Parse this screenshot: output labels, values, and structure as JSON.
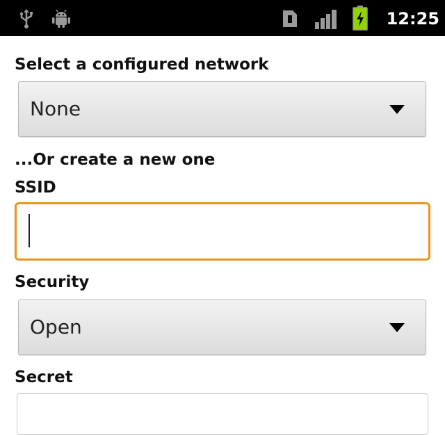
{
  "status_bar": {
    "time": "12:25",
    "icons": [
      "usb-icon",
      "android-debug-icon",
      "sim-card-icon",
      "signal-icon",
      "battery-charging-icon"
    ],
    "battery_color": "#8fd400"
  },
  "form": {
    "network_label": "Select a configured network",
    "network_value": "None",
    "create_label": "...Or create a new one",
    "ssid_label": "SSID",
    "ssid_value": "",
    "security_label": "Security",
    "security_value": "Open",
    "secret_label": "Secret",
    "secret_value": ""
  },
  "colors": {
    "focus_border": "#e8951c",
    "status_bar_bg": "#000000"
  }
}
